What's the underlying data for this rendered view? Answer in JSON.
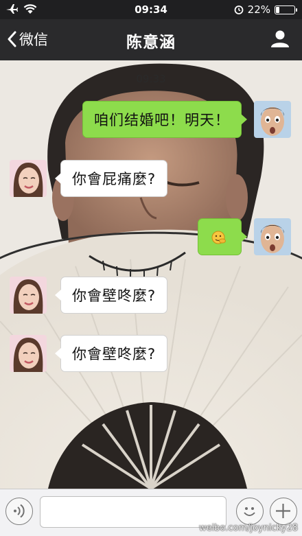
{
  "status_bar": {
    "time": "09:34",
    "battery_text": "22%",
    "battery_level": 0.22
  },
  "nav": {
    "back_label": "微信",
    "title": "陈意涵"
  },
  "chat": {
    "timestamp": "09:33",
    "messages": [
      {
        "sender": "me",
        "text": "咱们结婚吧！明天！"
      },
      {
        "sender": "other",
        "text": "你會屁痛麼?"
      },
      {
        "sender": "me",
        "text": "",
        "sticker": "shy-hand-face-emoji"
      },
      {
        "sender": "other",
        "text": "你會壁咚麼?"
      },
      {
        "sender": "other",
        "text": "你會壁咚麼?"
      }
    ]
  },
  "input_bar": {
    "message_value": "",
    "voice_icon": "voice-wave-icon",
    "emoji_icon": "smiley-icon",
    "more_icon": "plus-icon"
  },
  "watermark": "weibo.com/joynicky28"
}
